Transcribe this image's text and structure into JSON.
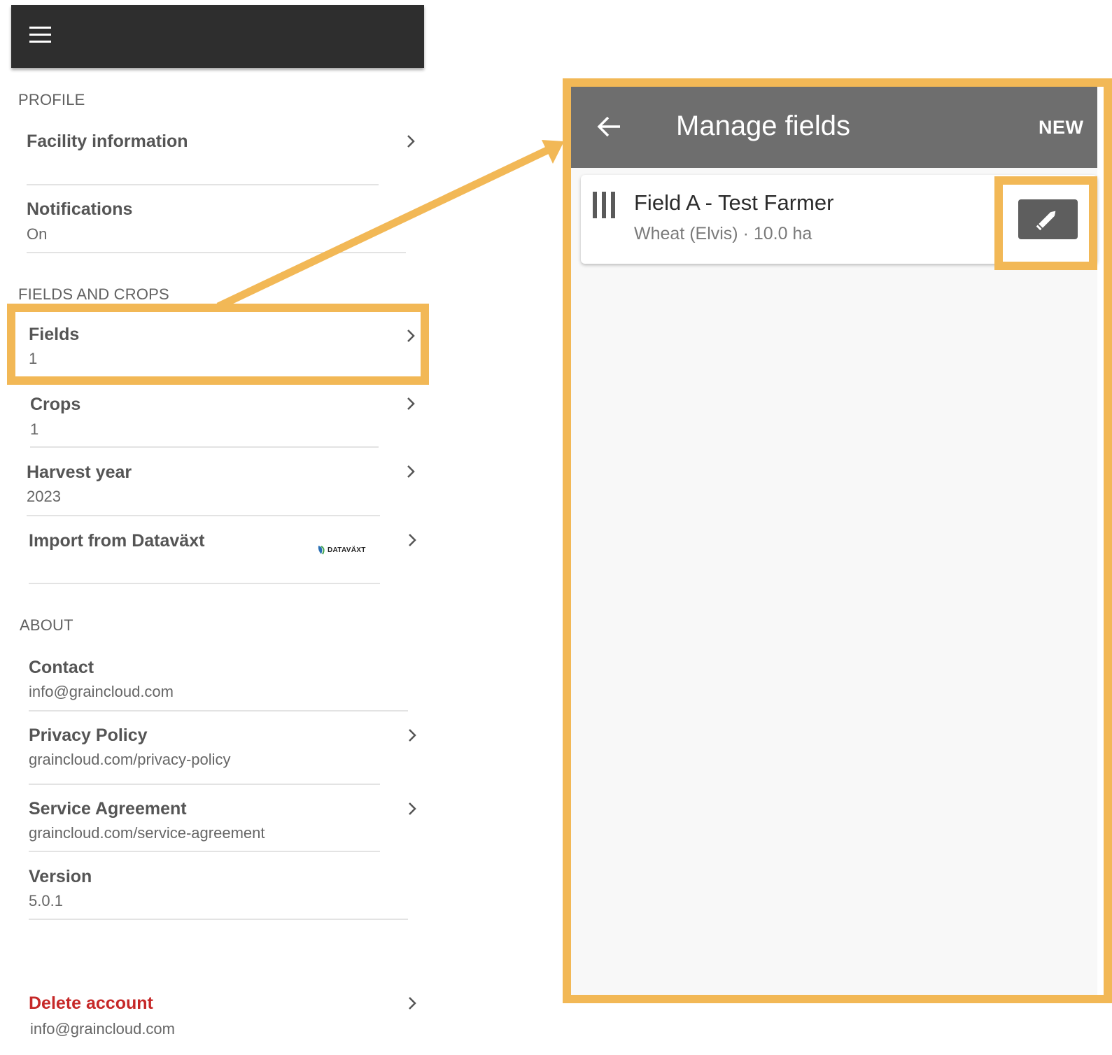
{
  "left": {
    "sections": {
      "profile": "PROFILE",
      "fields_crops": "FIELDS AND CROPS",
      "about": "ABOUT"
    },
    "items": {
      "facility": {
        "title": "Facility information"
      },
      "notifications": {
        "title": "Notifications",
        "value": "On"
      },
      "fields": {
        "title": "Fields",
        "value": "1"
      },
      "crops": {
        "title": "Crops",
        "value": "1"
      },
      "harvest_year": {
        "title": "Harvest year",
        "value": "2023"
      },
      "import": {
        "title": "Import from Dataväxt",
        "logo_text": "DATAVÄXT"
      },
      "contact": {
        "title": "Contact",
        "value": "info@graincloud.com"
      },
      "privacy": {
        "title": "Privacy Policy",
        "value": "graincloud.com/privacy-policy"
      },
      "service": {
        "title": "Service Agreement",
        "value": "graincloud.com/service-agreement"
      },
      "version": {
        "title": "Version",
        "value": "5.0.1"
      },
      "delete": {
        "title": "Delete account",
        "value": "info@graincloud.com"
      }
    },
    "icons": {
      "menu": "menu-icon",
      "chevron": "chevron-right-icon"
    }
  },
  "right": {
    "title": "Manage fields",
    "new_label": "NEW",
    "field": {
      "name": "Field A - Test Farmer",
      "details": "Wheat (Elvis) · 10.0 ha"
    },
    "icons": {
      "back": "arrow-left-icon",
      "drag": "drag-handle-icon",
      "edit": "pencil-icon"
    }
  },
  "colors": {
    "highlight": "#f2b856",
    "topbar_left": "#2e2e2e",
    "topbar_right": "#6e6e6e",
    "danger": "#c62828"
  }
}
